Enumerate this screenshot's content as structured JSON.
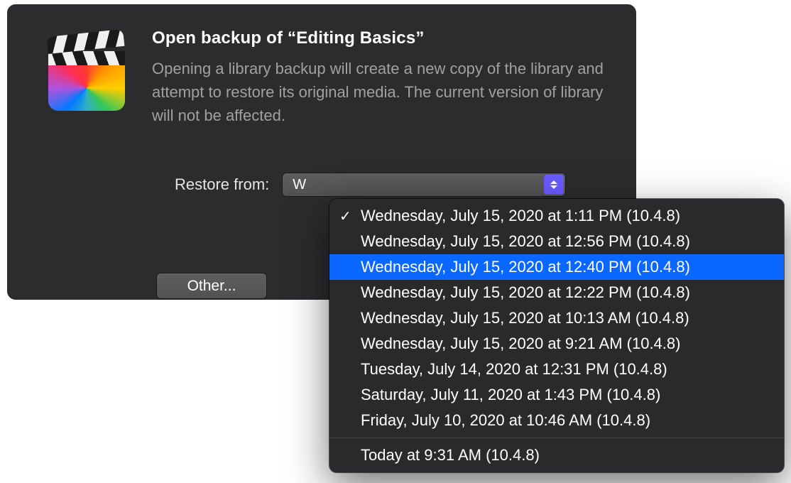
{
  "dialog": {
    "title": "Open backup of “Editing Basics”",
    "description": "Opening a library backup will create a new copy of the library and attempt to restore its original media. The current version of library will not be affected.",
    "restore_label": "Restore from:",
    "other_button": "Other...",
    "dropdown_selected_preview": "W"
  },
  "dropdown": {
    "selected_index": 0,
    "highlighted_index": 2,
    "items": [
      "Wednesday, July 15, 2020 at 1:11 PM (10.4.8)",
      "Wednesday, July 15, 2020 at 12:56 PM (10.4.8)",
      "Wednesday, July 15, 2020 at 12:40 PM (10.4.8)",
      "Wednesday, July 15, 2020 at 12:22 PM (10.4.8)",
      "Wednesday, July 15, 2020 at 10:13 AM (10.4.8)",
      "Wednesday, July 15, 2020 at 9:21 AM (10.4.8)",
      "Tuesday, July 14, 2020 at 12:31 PM (10.4.8)",
      "Saturday, July 11, 2020 at 1:43 PM (10.4.8)",
      "Friday, July 10, 2020 at 10:46 AM (10.4.8)"
    ],
    "footer_item": "Today at 9:31 AM (10.4.8)"
  }
}
